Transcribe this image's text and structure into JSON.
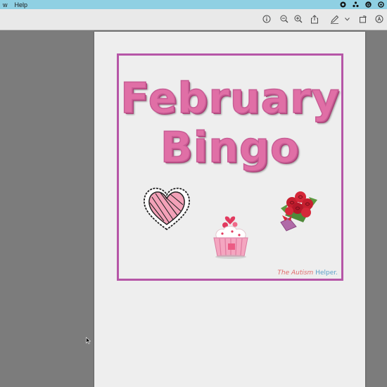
{
  "menubar": {
    "items": [
      "w",
      "Help"
    ]
  },
  "toolbar": {
    "icons": [
      "info-icon",
      "zoom-out-icon",
      "zoom-in-icon",
      "share-icon",
      "markup-icon",
      "chevron-down-icon",
      "rotate-icon",
      "search-icon"
    ]
  },
  "document": {
    "title_line1": "February",
    "title_line2": "Bingo",
    "watermark_part1": "The Autism",
    "watermark_part2": "Helper."
  },
  "colors": {
    "frame": "#b656a7",
    "title": "#e06fa6",
    "menubar": "#8fd0e3"
  }
}
